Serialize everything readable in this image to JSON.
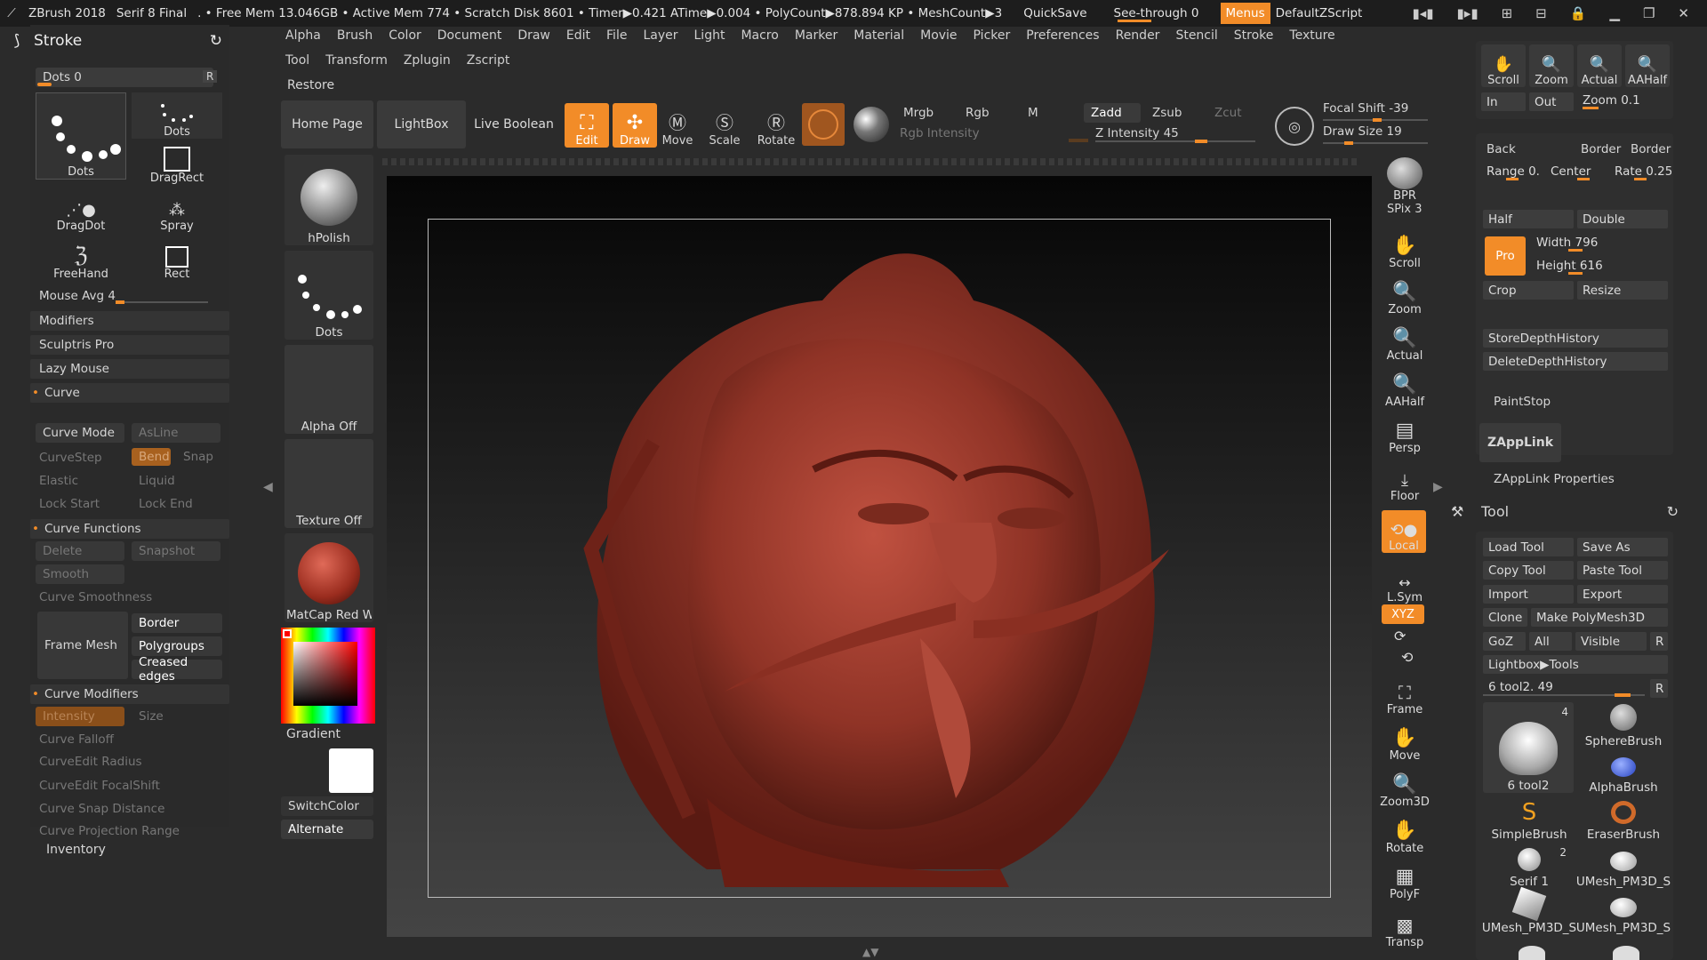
{
  "titlebar": {
    "app": "ZBrush 2018",
    "doc": "Serif 8 Final",
    "stats": ". • Free Mem 13.046GB • Active Mem 774 • Scratch Disk 8601 • Timer▶0.421 ATime▶0.004 • PolyCount▶878.894 KP • MeshCount▶3",
    "quicksave": "QuickSave",
    "seethrough": "See-through",
    "seethrough_val": "0",
    "menus": "Menus",
    "zscript": "DefaultZScript"
  },
  "menus": [
    "Alpha",
    "Brush",
    "Color",
    "Document",
    "Draw",
    "Edit",
    "File",
    "Layer",
    "Light",
    "Macro",
    "Marker",
    "Material",
    "Movie",
    "Picker",
    "Preferences",
    "Render",
    "Stencil",
    "Stroke",
    "Texture"
  ],
  "menus2": [
    "Tool",
    "Transform",
    "Zplugin",
    "Zscript"
  ],
  "restore": "Restore",
  "stroke": {
    "title": "Stroke",
    "dots_label": "Dots 0",
    "r": "R",
    "brushes": [
      "Dots",
      "Dots",
      "DragRect",
      "DragDot",
      "Spray",
      "FreeHand",
      "Rect"
    ],
    "mouse_avg": "Mouse Avg 4",
    "sections": [
      "Modifiers",
      "Sculptris Pro",
      "Lazy Mouse",
      "Curve"
    ],
    "curve_mode": "Curve Mode",
    "asline": "AsLine",
    "curvestep": "CurveStep",
    "bend": "Bend",
    "snap": "Snap",
    "elastic": "Elastic",
    "liquid": "Liquid",
    "lockstart": "Lock Start",
    "lockend": "Lock End",
    "curve_functions": "Curve Functions",
    "delete": "Delete",
    "snapshot": "Snapshot",
    "smooth": "Smooth",
    "curve_smoothness": "Curve Smoothness",
    "frame_mesh": "Frame Mesh",
    "border": "Border",
    "polygroups": "Polygroups",
    "creased": "Creased edges",
    "curve_modifiers": "Curve Modifiers",
    "intensity": "Intensity",
    "size": "Size",
    "falloff": "Curve Falloff",
    "ce_radius": "CurveEdit Radius",
    "ce_focal": "CurveEdit FocalShift",
    "snap_dist": "Curve Snap Distance",
    "proj_range": "Curve Projection Range",
    "inventory": "Inventory"
  },
  "top": {
    "home": "Home Page",
    "lightbox": "LightBox",
    "liveboolean": "Live Boolean",
    "edit": "Edit",
    "draw": "Draw",
    "move": "Move",
    "scale": "Scale",
    "rotate": "Rotate",
    "mrgb": "Mrgb",
    "rgb": "Rgb",
    "m": "M",
    "zadd": "Zadd",
    "zsub": "Zsub",
    "zcut": "Zcut",
    "rgb_intensity": "Rgb Intensity",
    "z_intensity": "Z Intensity 45",
    "focal": "Focal Shift -39",
    "drawsize": "Draw Size 19"
  },
  "leftshelf": {
    "hpolish": "hPolish",
    "dots": "Dots",
    "alpha": "Alpha Off",
    "texture": "Texture Off",
    "matcap": "MatCap Red Wa",
    "gradient": "Gradient",
    "switchcolor": "SwitchColor",
    "alternate": "Alternate"
  },
  "righttools": [
    "BPR",
    "SPix 3",
    "Scroll",
    "Zoom",
    "Actual",
    "AAHalf",
    "Persp",
    "Floor",
    "Local",
    "L.Sym",
    "XYZ",
    "Frame",
    "Move",
    "Zoom3D",
    "Rotate",
    "PolyF",
    "Transp"
  ],
  "rp": {
    "scroll": "Scroll",
    "zoom": "Zoom",
    "actual": "Actual",
    "aahalf": "AAHalf",
    "in": "In",
    "out": "Out",
    "zoomval": "Zoom 0.1",
    "back": "Back",
    "border": "Border",
    "border2": "Border",
    "range": "Range 0.",
    "center": "Center",
    "rate": "Rate 0.25",
    "half": "Half",
    "double": "Double",
    "pro": "Pro",
    "width": "Width 796",
    "height": "Height 616",
    "crop": "Crop",
    "resize": "Resize",
    "store": "StoreDepthHistory",
    "deletedh": "DeleteDepthHistory",
    "paintstop": "PaintStop",
    "zapplink": "ZAppLink",
    "zapplinkprops": "ZAppLink Properties",
    "tool": "Tool",
    "loadtool": "Load Tool",
    "saveas": "Save As",
    "copytool": "Copy Tool",
    "pastetool": "Paste Tool",
    "import": "Import",
    "export": "Export",
    "clone": "Clone",
    "makepoly": "Make PolyMesh3D",
    "goz": "GoZ",
    "all": "All",
    "visible": "Visible",
    "r": "R",
    "lightbox": "Lightbox▶Tools",
    "toolslider": "6 tool2. 49",
    "thumbs": [
      "6 tool2",
      "SphereBrush",
      "AlphaBrush",
      "SimpleBrush",
      "EraserBrush",
      "Serif 1",
      "UMesh_PM3D_S",
      "UMesh_PM3D_S",
      "UMesh_PM3D_S"
    ],
    "count4": "4",
    "count2": "2"
  },
  "colors": {
    "accent": "#f28c28",
    "bg": "#2b2b2b",
    "clay": "#9e3b2e"
  }
}
